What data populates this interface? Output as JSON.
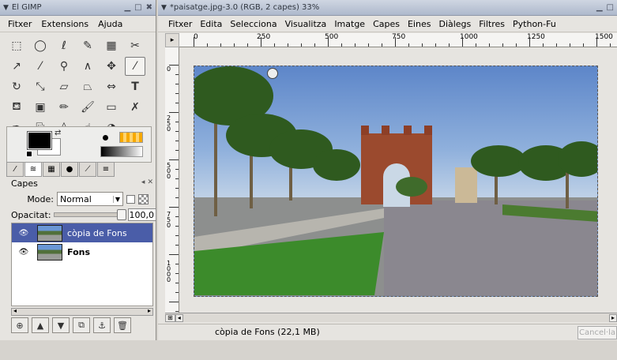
{
  "toolbox": {
    "title": "El GIMP",
    "menu": [
      "Fitxer",
      "Extensions",
      "Ajuda"
    ],
    "tools": [
      "rect-select",
      "ellipse-select",
      "lasso",
      "fuzzy-select",
      "color-select",
      "scissors",
      "paths",
      "color-picker",
      "zoom",
      "measure",
      "move",
      "crop",
      "rotate",
      "scale",
      "shear",
      "perspective",
      "flip",
      "text",
      "bucket-fill",
      "blend",
      "pencil",
      "paintbrush",
      "eraser",
      "airbrush",
      "ink",
      "clone",
      "convolve",
      "smudge",
      "dodge-burn"
    ],
    "colors": {
      "foreground": "#000000",
      "background": "#ffffff"
    }
  },
  "layers_dock": {
    "title": "Capes",
    "mode_label": "Mode:",
    "mode_value": "Normal",
    "opacity_label": "Opacitat:",
    "opacity_value": "100,0",
    "layers": [
      {
        "name": "còpia de Fons",
        "selected": true
      },
      {
        "name": "Fons",
        "selected": false
      }
    ]
  },
  "image_window": {
    "title": "*paisatge.jpg-3.0 (RGB, 2 capes) 33%",
    "menu": [
      "Fitxer",
      "Edita",
      "Selecciona",
      "Visualitza",
      "Imatge",
      "Capes",
      "Eines",
      "Diàlegs",
      "Filtres",
      "Python-Fu"
    ],
    "ruler_top": [
      "0",
      "250",
      "500",
      "750",
      "1000",
      "1250",
      "1500"
    ],
    "ruler_left": [
      "0",
      "250",
      "500",
      "750",
      "1000"
    ],
    "status": "còpia de Fons (22,1 MB)",
    "cancel": "Cancel·la"
  }
}
